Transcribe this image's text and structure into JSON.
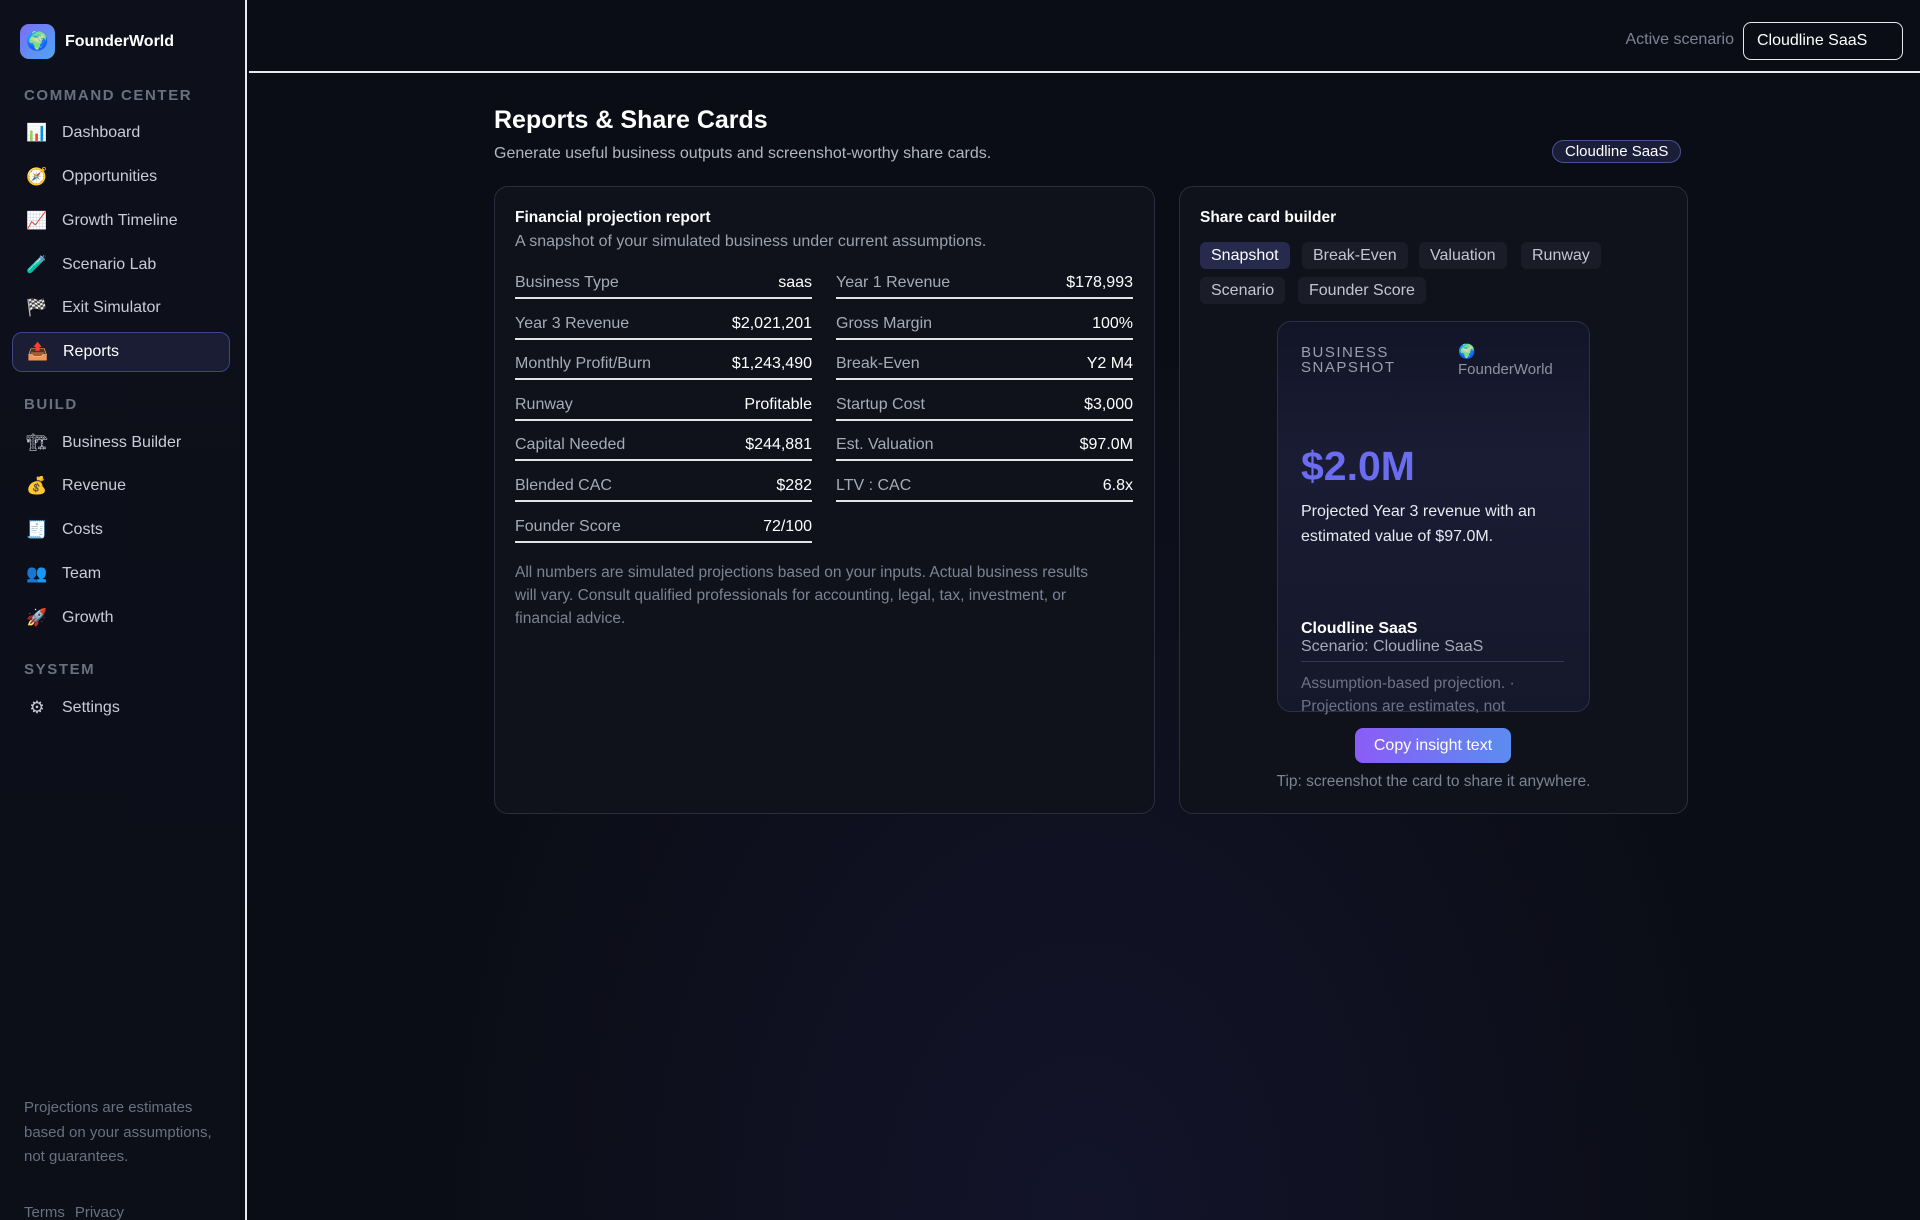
{
  "app": {
    "name": "FounderWorld",
    "logo_icon": "🌍"
  },
  "sidebar": {
    "sections": [
      {
        "title": "COMMAND CENTER",
        "items": [
          {
            "label": "Dashboard",
            "icon": "📊"
          },
          {
            "label": "Opportunities",
            "icon": "🧭"
          },
          {
            "label": "Growth Timeline",
            "icon": "📈"
          },
          {
            "label": "Scenario Lab",
            "icon": "🧪"
          },
          {
            "label": "Exit Simulator",
            "icon": "🏁"
          },
          {
            "label": "Reports",
            "icon": "📤",
            "active": true
          }
        ]
      },
      {
        "title": "BUILD",
        "items": [
          {
            "label": "Business Builder",
            "icon": "🏗"
          },
          {
            "label": "Revenue",
            "icon": "💰"
          },
          {
            "label": "Costs",
            "icon": "🧾"
          },
          {
            "label": "Team",
            "icon": "👥"
          },
          {
            "label": "Growth",
            "icon": "🚀"
          }
        ]
      },
      {
        "title": "SYSTEM",
        "items": [
          {
            "label": "Settings",
            "icon": "⚙"
          }
        ]
      }
    ],
    "footer_note": "Projections are estimates based on your assumptions, not guarantees.",
    "links": [
      "Terms",
      "Privacy"
    ]
  },
  "topbar": {
    "scenario_label": "Active scenario",
    "scenario_value": "Cloudline SaaS"
  },
  "page": {
    "title": "Reports & Share Cards",
    "subtitle": "Generate useful business outputs and screenshot-worthy share cards.",
    "badge": "Cloudline SaaS"
  },
  "report": {
    "title": "Financial projection report",
    "subtitle": "A snapshot of your simulated business under current assumptions.",
    "left": [
      {
        "k": "Business Type",
        "v": "saas"
      },
      {
        "k": "Year 3 Revenue",
        "v": "$2,021,201"
      },
      {
        "k": "Monthly Profit/Burn",
        "v": "$1,243,490"
      },
      {
        "k": "Runway",
        "v": "Profitable"
      },
      {
        "k": "Capital Needed",
        "v": "$244,881"
      },
      {
        "k": "Blended CAC",
        "v": "$282"
      },
      {
        "k": "Founder Score",
        "v": "72/100"
      }
    ],
    "right": [
      {
        "k": "Year 1 Revenue",
        "v": "$178,993"
      },
      {
        "k": "Gross Margin",
        "v": "100%"
      },
      {
        "k": "Break-Even",
        "v": "Y2 M4"
      },
      {
        "k": "Startup Cost",
        "v": "$3,000"
      },
      {
        "k": "Est. Valuation",
        "v": "$97.0M"
      },
      {
        "k": "LTV : CAC",
        "v": "6.8x"
      }
    ],
    "disclaimer": "All numbers are simulated projections based on your inputs. Actual business results will vary. Consult qualified professionals for accounting, legal, tax, investment, or financial advice."
  },
  "share": {
    "title": "Share card builder",
    "chips": [
      "Snapshot",
      "Break-Even",
      "Valuation",
      "Runway",
      "Scenario",
      "Founder Score"
    ],
    "active_chip": "Snapshot",
    "card": {
      "eyebrow": "BUSINESS SNAPSHOT",
      "brand": "FounderWorld",
      "big_value": "$2.0M",
      "description": "Projected Year 3 revenue with an estimated value of $97.0M.",
      "name": "Cloudline SaaS",
      "scenario": "Scenario: Cloudline SaaS",
      "note": "Assumption-based projection. · Projections are estimates, not"
    },
    "copy_button": "Copy insight text",
    "tip": "Tip: screenshot the card to share it anywhere."
  },
  "colors": {
    "accent": "#6a6df0",
    "active_nav_border": "#3d4488",
    "button_from": "#8b5cf6",
    "button_to": "#5b8def"
  }
}
